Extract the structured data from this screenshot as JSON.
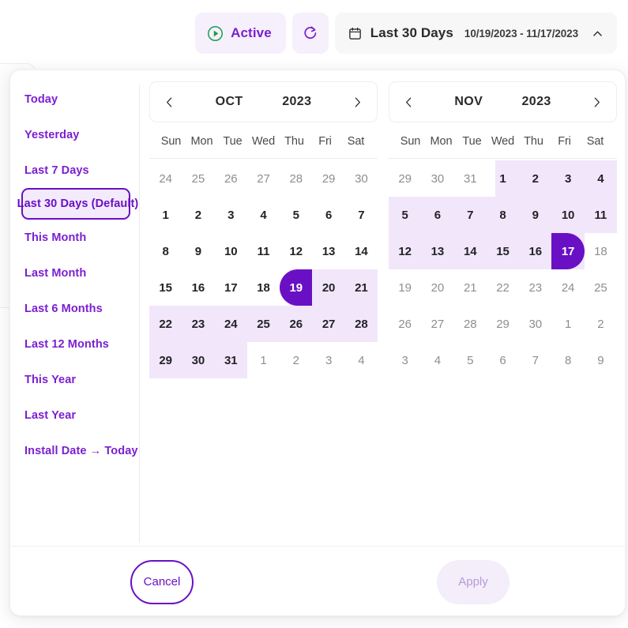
{
  "toolbar": {
    "status_label": "Active",
    "status_icon": "play-circle-icon",
    "status_color": "#1a9e4b",
    "refresh_icon": "refresh-icon",
    "calendar_icon": "calendar-icon",
    "range_preset_label": "Last 30 Days",
    "range_dates": "10/19/2023 - 11/17/2023",
    "collapse_icon": "chevron-up-icon",
    "accent_color": "#7b1fd1"
  },
  "presets": {
    "items": [
      {
        "label": "Today",
        "selected": false
      },
      {
        "label": "Yesterday",
        "selected": false
      },
      {
        "label": "Last 7 Days",
        "selected": false
      },
      {
        "label": "Last 30 Days (Default)",
        "selected": true
      },
      {
        "label": "This Month",
        "selected": false
      },
      {
        "label": "Last Month",
        "selected": false
      },
      {
        "label": "Last 6 Months",
        "selected": false
      },
      {
        "label": "Last 12 Months",
        "selected": false
      },
      {
        "label": "This Year",
        "selected": false
      },
      {
        "label": "Last Year",
        "selected": false
      },
      {
        "label": "Install Date → Today",
        "selected": false
      }
    ]
  },
  "weekdays": [
    "Sun",
    "Mon",
    "Tue",
    "Wed",
    "Thu",
    "Fri",
    "Sat"
  ],
  "calendars": [
    {
      "month": "OCT",
      "year": "2023",
      "prev_icon": "chevron-left-icon",
      "next_icon": "chevron-right-icon",
      "weeks": [
        [
          {
            "d": "24",
            "state": "muted"
          },
          {
            "d": "25",
            "state": "muted"
          },
          {
            "d": "26",
            "state": "muted"
          },
          {
            "d": "27",
            "state": "muted"
          },
          {
            "d": "28",
            "state": "muted"
          },
          {
            "d": "29",
            "state": "muted"
          },
          {
            "d": "30",
            "state": "muted"
          }
        ],
        [
          {
            "d": "1",
            "state": "normal"
          },
          {
            "d": "2",
            "state": "normal"
          },
          {
            "d": "3",
            "state": "normal"
          },
          {
            "d": "4",
            "state": "normal"
          },
          {
            "d": "5",
            "state": "normal"
          },
          {
            "d": "6",
            "state": "normal"
          },
          {
            "d": "7",
            "state": "normal"
          }
        ],
        [
          {
            "d": "8",
            "state": "normal"
          },
          {
            "d": "9",
            "state": "normal"
          },
          {
            "d": "10",
            "state": "normal"
          },
          {
            "d": "11",
            "state": "normal"
          },
          {
            "d": "12",
            "state": "normal"
          },
          {
            "d": "13",
            "state": "normal"
          },
          {
            "d": "14",
            "state": "normal"
          }
        ],
        [
          {
            "d": "15",
            "state": "normal"
          },
          {
            "d": "16",
            "state": "normal"
          },
          {
            "d": "17",
            "state": "normal"
          },
          {
            "d": "18",
            "state": "normal"
          },
          {
            "d": "19",
            "state": "range-start"
          },
          {
            "d": "20",
            "state": "in-range"
          },
          {
            "d": "21",
            "state": "in-range"
          }
        ],
        [
          {
            "d": "22",
            "state": "in-range"
          },
          {
            "d": "23",
            "state": "in-range"
          },
          {
            "d": "24",
            "state": "in-range"
          },
          {
            "d": "25",
            "state": "in-range"
          },
          {
            "d": "26",
            "state": "in-range"
          },
          {
            "d": "27",
            "state": "in-range"
          },
          {
            "d": "28",
            "state": "in-range"
          }
        ],
        [
          {
            "d": "29",
            "state": "in-range"
          },
          {
            "d": "30",
            "state": "in-range"
          },
          {
            "d": "31",
            "state": "in-range"
          },
          {
            "d": "1",
            "state": "muted"
          },
          {
            "d": "2",
            "state": "muted"
          },
          {
            "d": "3",
            "state": "muted"
          },
          {
            "d": "4",
            "state": "muted"
          }
        ]
      ],
      "bands": [
        {
          "week": 3,
          "from": 4,
          "to": 6
        },
        {
          "week": 4,
          "from": 0,
          "to": 6
        },
        {
          "week": 5,
          "from": 0,
          "to": 2
        }
      ]
    },
    {
      "month": "NOV",
      "year": "2023",
      "prev_icon": "chevron-left-icon",
      "next_icon": "chevron-right-icon",
      "weeks": [
        [
          {
            "d": "29",
            "state": "muted"
          },
          {
            "d": "30",
            "state": "muted"
          },
          {
            "d": "31",
            "state": "muted"
          },
          {
            "d": "1",
            "state": "in-range"
          },
          {
            "d": "2",
            "state": "in-range"
          },
          {
            "d": "3",
            "state": "in-range"
          },
          {
            "d": "4",
            "state": "in-range"
          }
        ],
        [
          {
            "d": "5",
            "state": "in-range"
          },
          {
            "d": "6",
            "state": "in-range"
          },
          {
            "d": "7",
            "state": "in-range"
          },
          {
            "d": "8",
            "state": "in-range"
          },
          {
            "d": "9",
            "state": "in-range"
          },
          {
            "d": "10",
            "state": "in-range"
          },
          {
            "d": "11",
            "state": "in-range"
          }
        ],
        [
          {
            "d": "12",
            "state": "in-range"
          },
          {
            "d": "13",
            "state": "in-range"
          },
          {
            "d": "14",
            "state": "in-range"
          },
          {
            "d": "15",
            "state": "in-range"
          },
          {
            "d": "16",
            "state": "in-range"
          },
          {
            "d": "17",
            "state": "range-end"
          },
          {
            "d": "18",
            "state": "muted"
          }
        ],
        [
          {
            "d": "19",
            "state": "muted"
          },
          {
            "d": "20",
            "state": "muted"
          },
          {
            "d": "21",
            "state": "muted"
          },
          {
            "d": "22",
            "state": "muted"
          },
          {
            "d": "23",
            "state": "muted"
          },
          {
            "d": "24",
            "state": "muted"
          },
          {
            "d": "25",
            "state": "muted"
          }
        ],
        [
          {
            "d": "26",
            "state": "muted"
          },
          {
            "d": "27",
            "state": "muted"
          },
          {
            "d": "28",
            "state": "muted"
          },
          {
            "d": "29",
            "state": "muted"
          },
          {
            "d": "30",
            "state": "muted"
          },
          {
            "d": "1",
            "state": "muted"
          },
          {
            "d": "2",
            "state": "muted"
          }
        ],
        [
          {
            "d": "3",
            "state": "muted"
          },
          {
            "d": "4",
            "state": "muted"
          },
          {
            "d": "5",
            "state": "muted"
          },
          {
            "d": "6",
            "state": "muted"
          },
          {
            "d": "7",
            "state": "muted"
          },
          {
            "d": "8",
            "state": "muted"
          },
          {
            "d": "9",
            "state": "muted"
          }
        ]
      ],
      "bands": [
        {
          "week": 0,
          "from": 3,
          "to": 6
        },
        {
          "week": 1,
          "from": 0,
          "to": 6
        },
        {
          "week": 2,
          "from": 0,
          "to": 5
        }
      ]
    }
  ],
  "footer": {
    "cancel_label": "Cancel",
    "apply_label": "Apply",
    "apply_disabled": true
  },
  "colors": {
    "accent": "#6a10c4",
    "accent_light": "#7b1fd1",
    "range_fill": "#f1e6fa",
    "green": "#1a9e4b"
  }
}
